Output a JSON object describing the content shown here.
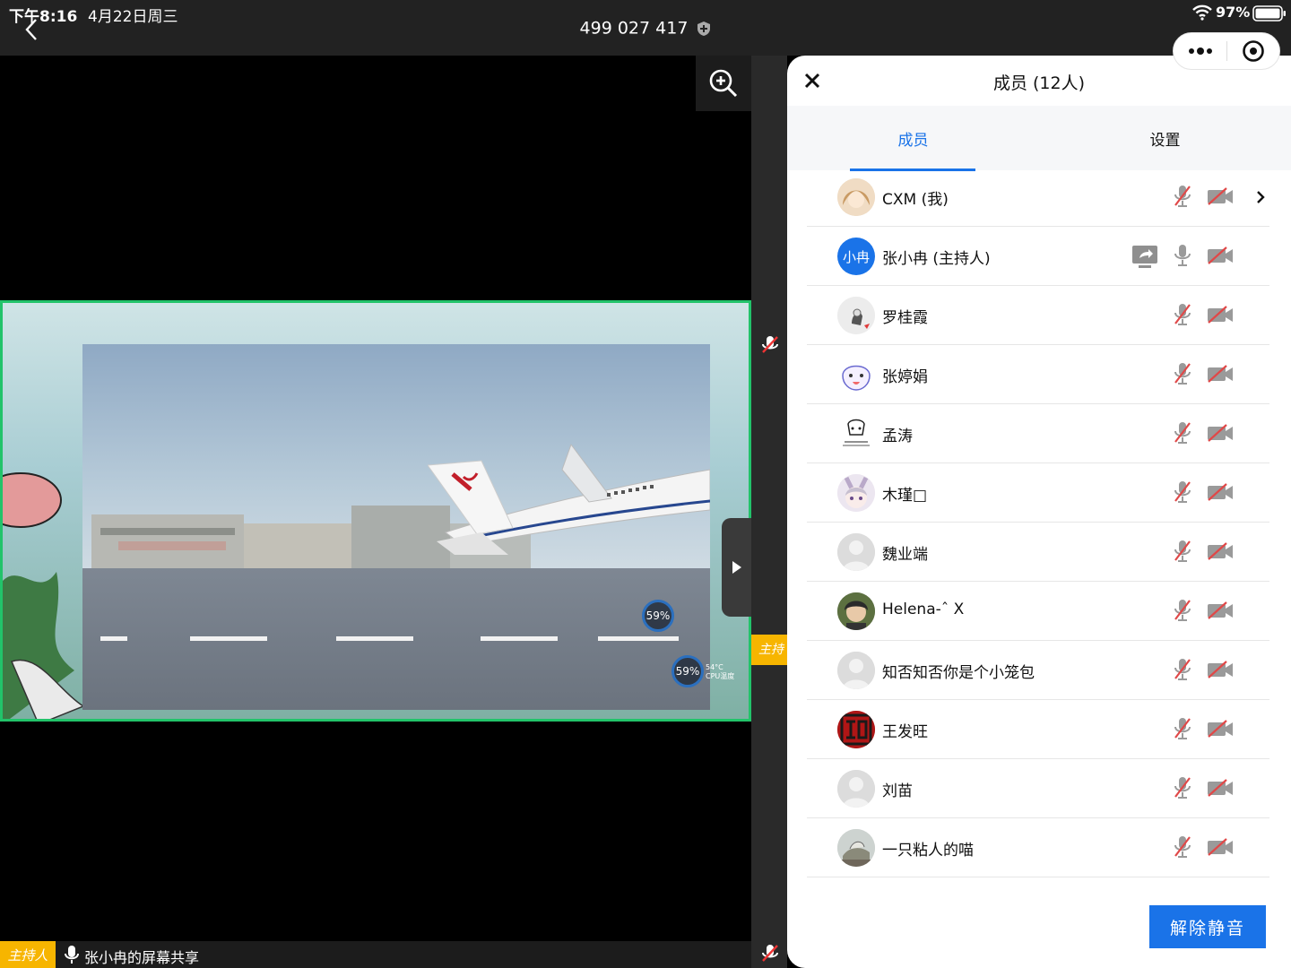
{
  "status_bar": {
    "time": "下午8:16",
    "date": "4月22日周三",
    "meeting_id": "499 027 417",
    "battery": "97%"
  },
  "main_video": {
    "gauge_1": "59%",
    "gauge_2": "59%",
    "gauge_2_temp": "54°C",
    "gauge_2_label": "CPU温度"
  },
  "strip": {
    "host_tag": "主持"
  },
  "bottom": {
    "host_tag": "主持人",
    "share_label": "张小冉的屏幕共享"
  },
  "panel": {
    "title": "成员 (12人)",
    "tabs": [
      {
        "label": "成员",
        "active": true
      },
      {
        "label": "设置",
        "active": false
      }
    ],
    "members": [
      {
        "name": "CXM (我)",
        "avatar": "photo",
        "mic_muted": true,
        "cam_off": true,
        "chevron": true
      },
      {
        "name": "张小冉 (主持人)",
        "avatar_text": "小冉",
        "mic_muted": false,
        "cam_off": true,
        "sharing": true
      },
      {
        "name": "罗桂霞",
        "avatar": "photo",
        "mic_muted": true,
        "cam_off": true
      },
      {
        "name": "张婷娟",
        "avatar": "photo",
        "mic_muted": true,
        "cam_off": true
      },
      {
        "name": "孟涛",
        "avatar": "photo",
        "mic_muted": true,
        "cam_off": true
      },
      {
        "name": "木瑾□",
        "avatar": "photo",
        "mic_muted": true,
        "cam_off": true
      },
      {
        "name": "魏业端",
        "avatar": "default",
        "mic_muted": true,
        "cam_off": true
      },
      {
        "name": "Helena-ˆ X",
        "avatar": "photo",
        "mic_muted": true,
        "cam_off": true
      },
      {
        "name": "知否知否你是个小笼包",
        "avatar": "default",
        "mic_muted": true,
        "cam_off": true
      },
      {
        "name": "王发旺",
        "avatar": "photo",
        "mic_muted": true,
        "cam_off": true
      },
      {
        "name": "刘苗",
        "avatar": "default",
        "mic_muted": true,
        "cam_off": true
      },
      {
        "name": "一只粘人的喵",
        "avatar": "photo",
        "mic_muted": true,
        "cam_off": true
      }
    ],
    "unmute_label": "解除静音"
  },
  "colors": {
    "accent": "#1a73e8",
    "host": "#f7b500",
    "share_border": "#22c36a"
  }
}
